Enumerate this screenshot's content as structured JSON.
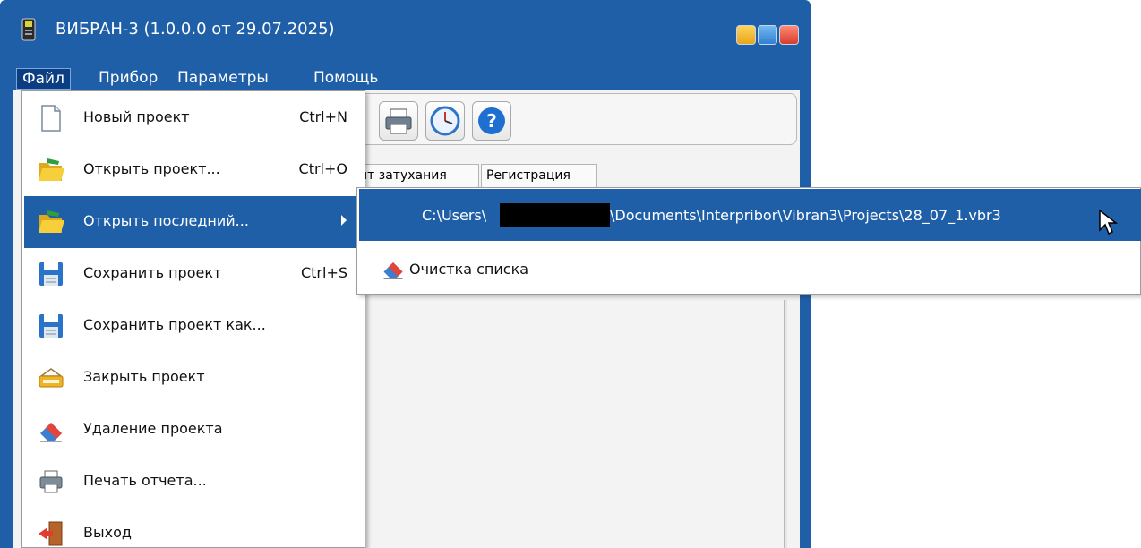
{
  "window": {
    "title": "ВИБРАН-3 (1.0.0.0 от 29.07.2025)"
  },
  "menubar": {
    "items": [
      "Файл",
      "Прибор",
      "Параметры",
      "Помощь"
    ]
  },
  "tabs": [
    "нт затухания",
    "Регистрация"
  ],
  "file_menu": {
    "items": [
      {
        "label": "Новый проект",
        "shortcut": "Ctrl+N",
        "icon": "new-document-icon"
      },
      {
        "label": "Открыть проект...",
        "shortcut": "Ctrl+O",
        "icon": "open-folder-icon"
      },
      {
        "label": "Открыть последний...",
        "shortcut": "",
        "icon": "open-folder-icon"
      },
      {
        "label": "Сохранить проект",
        "shortcut": "Ctrl+S",
        "icon": "floppy-disk-icon"
      },
      {
        "label": "Сохранить проект как...",
        "shortcut": "",
        "icon": "floppy-disk-icon"
      },
      {
        "label": "Закрыть проект",
        "shortcut": "",
        "icon": "close-sign-icon"
      },
      {
        "label": "Удаление проекта",
        "shortcut": "",
        "icon": "eraser-icon"
      },
      {
        "label": "Печать отчета...",
        "shortcut": "",
        "icon": "printer-icon"
      },
      {
        "label": "Выход",
        "shortcut": "",
        "icon": "exit-door-icon"
      }
    ]
  },
  "recent_submenu": {
    "path_prefix": "C:\\Users\\",
    "path_suffix": "\\Documents\\Interpribor\\Vibran3\\Projects\\28_07_1.vbr3",
    "clear_label": "Очистка списка"
  },
  "colors": {
    "titlebar": "#1f5fa8",
    "highlight": "#1f5fa8"
  }
}
